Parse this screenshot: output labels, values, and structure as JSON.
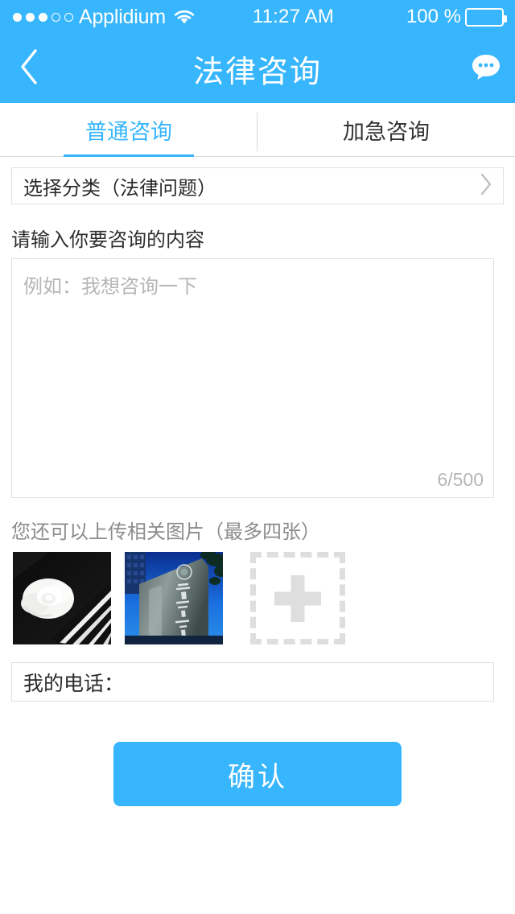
{
  "status_bar": {
    "carrier": "Applidium",
    "time": "11:27 AM",
    "battery_label": "100 %",
    "battery_percent": 100,
    "signal_dots_filled": 3,
    "signal_dots_total": 5,
    "wifi_icon": "wifi-icon"
  },
  "nav": {
    "title": "法律咨询",
    "back_icon": "chevron-left-icon",
    "action_icon": "chat-bubble-icon"
  },
  "tabs": {
    "items": [
      {
        "label": "普通咨询",
        "active": true
      },
      {
        "label": "加急咨询",
        "active": false
      }
    ]
  },
  "form": {
    "category": {
      "label": "选择分类（法律问题）",
      "chevron": "chevron-right-icon"
    },
    "content": {
      "label": "请输入你要咨询的内容",
      "placeholder": "例如：我想咨询一下",
      "value": "",
      "counter": "6/500",
      "char_count": 6,
      "char_limit": 500
    },
    "upload": {
      "label": "您还可以上传相关图片（最多四张）",
      "max_images": 4,
      "thumbnails": [
        {
          "name": "white-rose-on-piano-keys"
        },
        {
          "name": "stone-monument-building-sign"
        }
      ],
      "add_button": {
        "icon": "plus-icon"
      }
    },
    "phone": {
      "label": "我的电话：",
      "value": "",
      "placeholder": ""
    },
    "submit": {
      "label": "确认"
    }
  },
  "colors": {
    "accent": "#38b6fd",
    "text": "#2b2b2b",
    "muted": "#b6b6b6",
    "border": "#e0e0e0"
  }
}
